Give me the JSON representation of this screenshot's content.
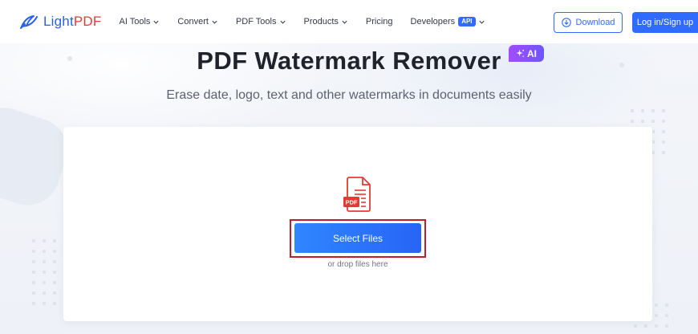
{
  "nav": {
    "logo": {
      "text_main": "Light",
      "text_accent": "PDF"
    },
    "menu": [
      {
        "label": "AI Tools",
        "has_dropdown": true
      },
      {
        "label": "Convert",
        "has_dropdown": true
      },
      {
        "label": "PDF Tools",
        "has_dropdown": true
      },
      {
        "label": "Products",
        "has_dropdown": true
      },
      {
        "label": "Pricing",
        "has_dropdown": false
      },
      {
        "label": "Developers",
        "badge": "API",
        "has_dropdown": true
      }
    ],
    "download_label": "Download",
    "login_label": "Log in/Sign up"
  },
  "hero": {
    "title": "PDF Watermark Remover",
    "ai_badge": "AI",
    "subtitle": "Erase date, logo, text and other watermarks in documents easily"
  },
  "upload": {
    "file_icon_label": "PDF",
    "select_label": "Select Files",
    "drop_hint": "or drop files here"
  },
  "colors": {
    "brand_blue": "#2f6bff",
    "brand_red": "#e53b35",
    "highlight_outline": "#c11f25",
    "ai_gradient_start": "#a24dff",
    "ai_gradient_end": "#6d56ff"
  },
  "icons": [
    "logo-swoosh-icon",
    "chevron-down-icon",
    "download-circle-icon",
    "sparkle-icon",
    "pdf-file-icon"
  ]
}
